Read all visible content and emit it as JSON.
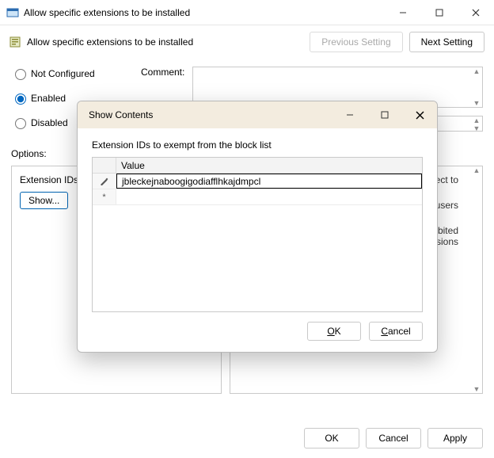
{
  "window": {
    "title": "Allow specific extensions to be installed",
    "controls": {
      "minimize": "–",
      "maximize": "▢",
      "close": "✕"
    }
  },
  "header": {
    "title": "Allow specific extensions to be installed",
    "prev": "Previous Setting",
    "next": "Next Setting"
  },
  "radios": {
    "not_configured": "Not Configured",
    "enabled": "Enabled",
    "disabled": "Disabled",
    "selected": "enabled"
  },
  "comment_label": "Comment:",
  "options_label": "Options:",
  "options_left": {
    "heading": "Extension IDs to e",
    "show_btn": "Show..."
  },
  "options_right": {
    "line1_tail": "subject to",
    "line2_tail": "and users",
    "line3a_tail": "prohibited",
    "line3b_tail": "tensions"
  },
  "footer": {
    "ok": "OK",
    "cancel": "Cancel",
    "apply": "Apply"
  },
  "dialog": {
    "title": "Show Contents",
    "controls": {
      "minimize": "–",
      "maximize": "▢",
      "close": "✕"
    },
    "subheading": "Extension IDs to exempt from the block list",
    "col_header": "Value",
    "rows": [
      {
        "marker": "✎",
        "value": "jbleckejnaboogigodiafflhkajdmpcl"
      },
      {
        "marker": "*",
        "value": ""
      }
    ],
    "ok_label": "OK",
    "cancel_label": "Cancel",
    "ok_mnemonic": "O",
    "cancel_mnemonic": "C"
  }
}
